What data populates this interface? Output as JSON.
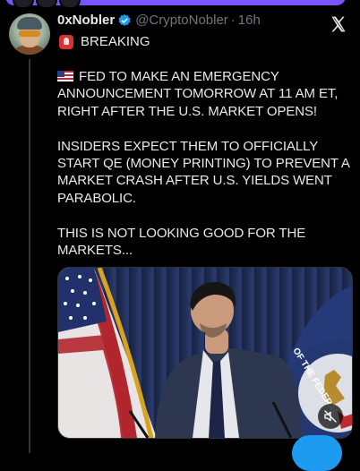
{
  "post": {
    "author_name": "0xNobler",
    "handle": "@CryptoNobler",
    "separator": "·",
    "time": "16h",
    "breaking_label": "BREAKING",
    "paragraphs": [
      "FED TO MAKE AN EMERGENCY ANNOUNCEMENT TOMORROW AT 11 AM ET, RIGHT AFTER THE U.S. MARKET OPENS!",
      "INSIDERS EXPECT THEM TO OFFICIALLY START QE (MONEY PRINTING) TO PREVENT A MARKET CRASH AFTER U.S. YIELDS WENT PARABOLIC.",
      "THIS IS NOT LOOKING GOOD FOR THE MARKETS..."
    ]
  },
  "media": {
    "seal_text": "OF THE FEDERAL"
  },
  "icons": {
    "verified": "verified-badge-icon",
    "x_logo": "x-logo-icon",
    "siren": "siren-icon",
    "flag": "us-flag-icon",
    "mute": "muted-speaker-icon"
  },
  "colors": {
    "background": "#000000",
    "text": "#e7e9ea",
    "muted_text": "#71767b",
    "accent": "#1d9bf0",
    "top_pill": "#7856ff"
  }
}
